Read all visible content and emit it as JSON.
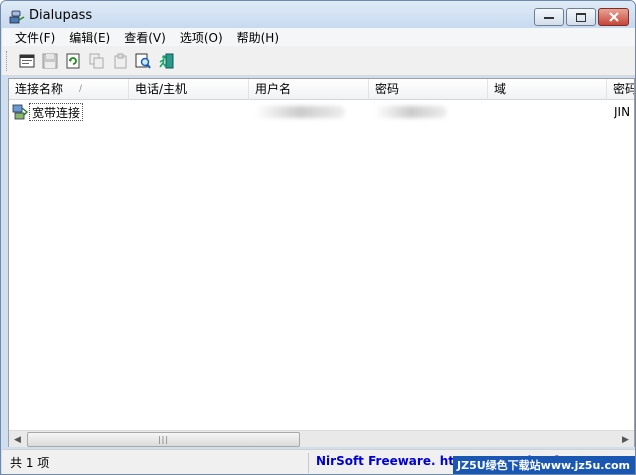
{
  "app": {
    "title": "Dialupass"
  },
  "menu": [
    "文件(F)",
    "编辑(E)",
    "查看(V)",
    "选项(O)",
    "帮助(H)"
  ],
  "columns": [
    "连接名称",
    "电话/主机",
    "用户名",
    "密码",
    "域",
    "密码"
  ],
  "rows": [
    {
      "name": "宽带连接",
      "phone": "",
      "user": "",
      "password": "",
      "domain": "",
      "extra": "JIN"
    }
  ],
  "status": {
    "count": "共 1 项",
    "link": "NirSoft Freeware.  http://www.nirsoft.net"
  },
  "watermark": "JZ5U绿色下载站www.jz5u.com",
  "colors": {
    "watermark_bg": "#1a57b3",
    "link": "#0000d0",
    "close_button": "#c6463a"
  }
}
